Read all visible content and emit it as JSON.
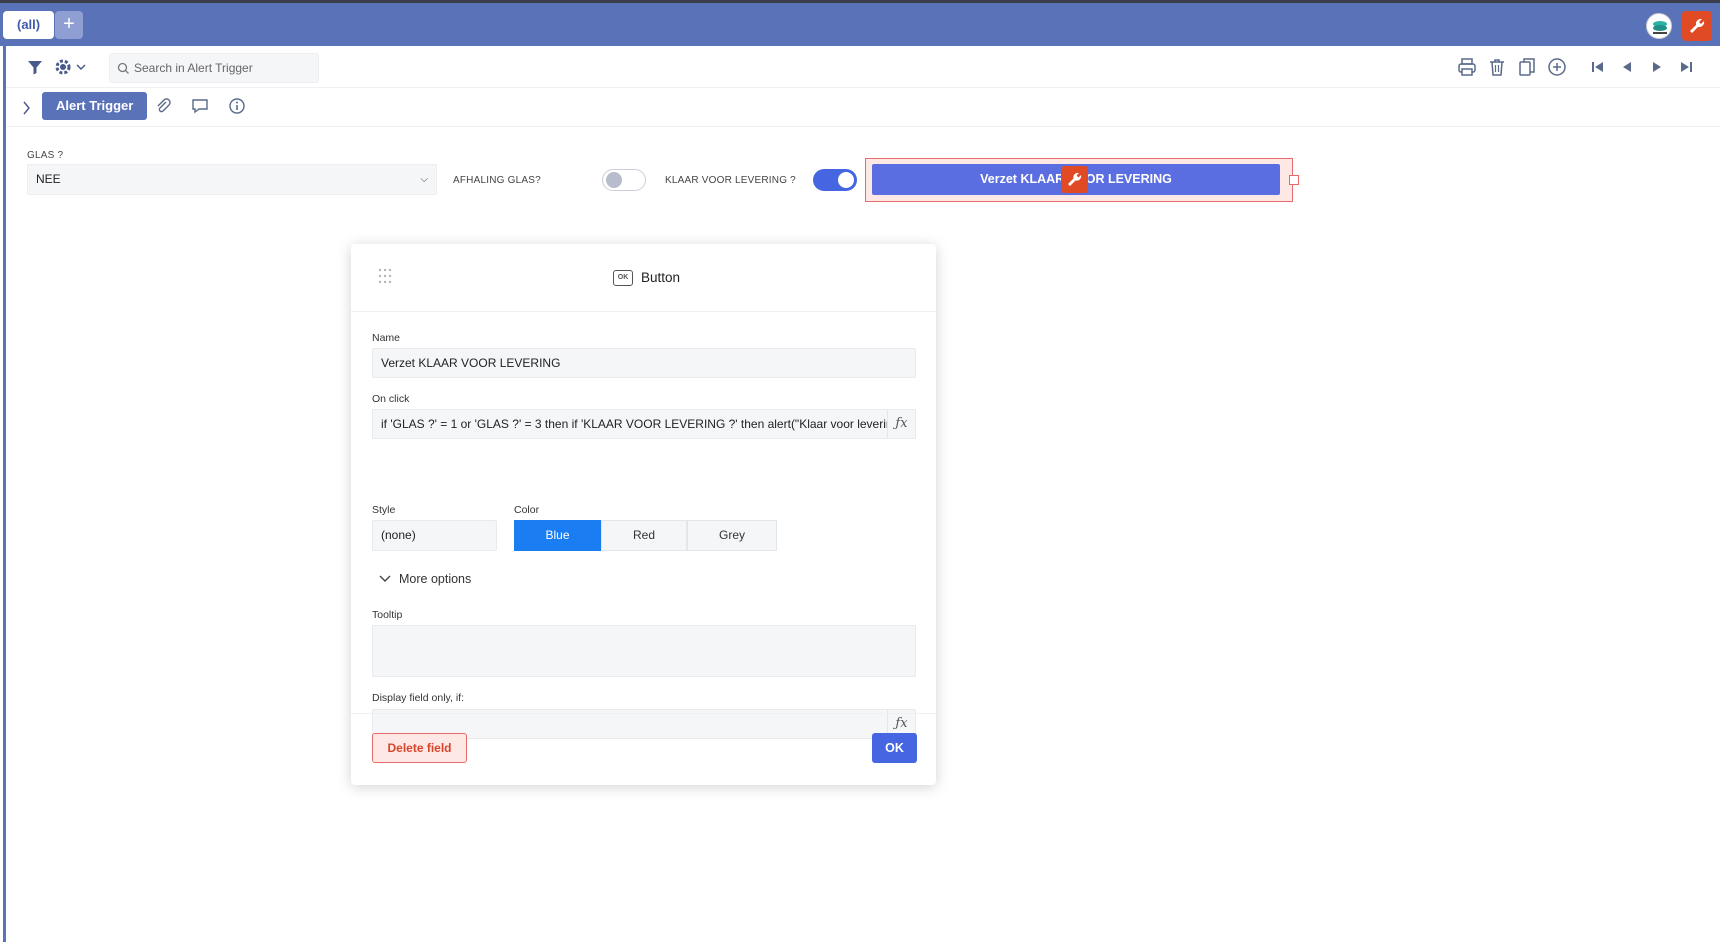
{
  "topbar": {
    "tab_all": "(all)",
    "tab_add": "+",
    "avatar_icon": "app-logo-icon",
    "wrench_icon": "wrench-icon"
  },
  "toolbar": {
    "search_placeholder": "Search in Alert Trigger",
    "left_icons": [
      "filter-icon",
      "gear-icon",
      "chevron-down-icon"
    ],
    "right_icons": [
      "print-icon",
      "trash-icon",
      "copy-icon",
      "add-circle-icon",
      "first-icon",
      "prev-icon",
      "next-icon",
      "last-icon"
    ]
  },
  "subbar": {
    "alert_trigger_label": "Alert Trigger",
    "icons": [
      "chevron-right-icon",
      "paperclip-icon",
      "comment-icon",
      "info-icon"
    ]
  },
  "form": {
    "glas_label": "GLAS ?",
    "glas_value": "NEE",
    "afhaling_label": "AFHALING GLAS?",
    "afhaling_on": false,
    "klaar_label": "KLAAR VOOR LEVERING ?",
    "klaar_on": true,
    "verzet_button_label": "Verzet KLAAR VOOR LEVERING"
  },
  "modal": {
    "title": "Button",
    "title_icon_text": "OK",
    "name_label": "Name",
    "name_value": "Verzet KLAAR VOOR LEVERING",
    "onclick_label": "On click",
    "onclick_value": "if 'GLAS ?' = 1 or 'GLAS ?' = 3 then if 'KLAAR VOOR LEVERING ?' then alert(\"Klaar voor levering",
    "fx_symbol": "ƒx",
    "style_label": "Style",
    "style_value": "(none)",
    "color_label": "Color",
    "colors": [
      "Blue",
      "Red",
      "Grey"
    ],
    "active_color": "Blue",
    "more_options": "More options",
    "tooltip_label": "Tooltip",
    "tooltip_value": "",
    "display_label": "Display field only, if:",
    "display_value": "",
    "delete_label": "Delete field",
    "ok_label": "OK"
  },
  "colors": {
    "topbar": "#5a72b8",
    "accent": "#4566e0",
    "active_segment": "#1a7ef2",
    "danger": "#e04a25"
  }
}
